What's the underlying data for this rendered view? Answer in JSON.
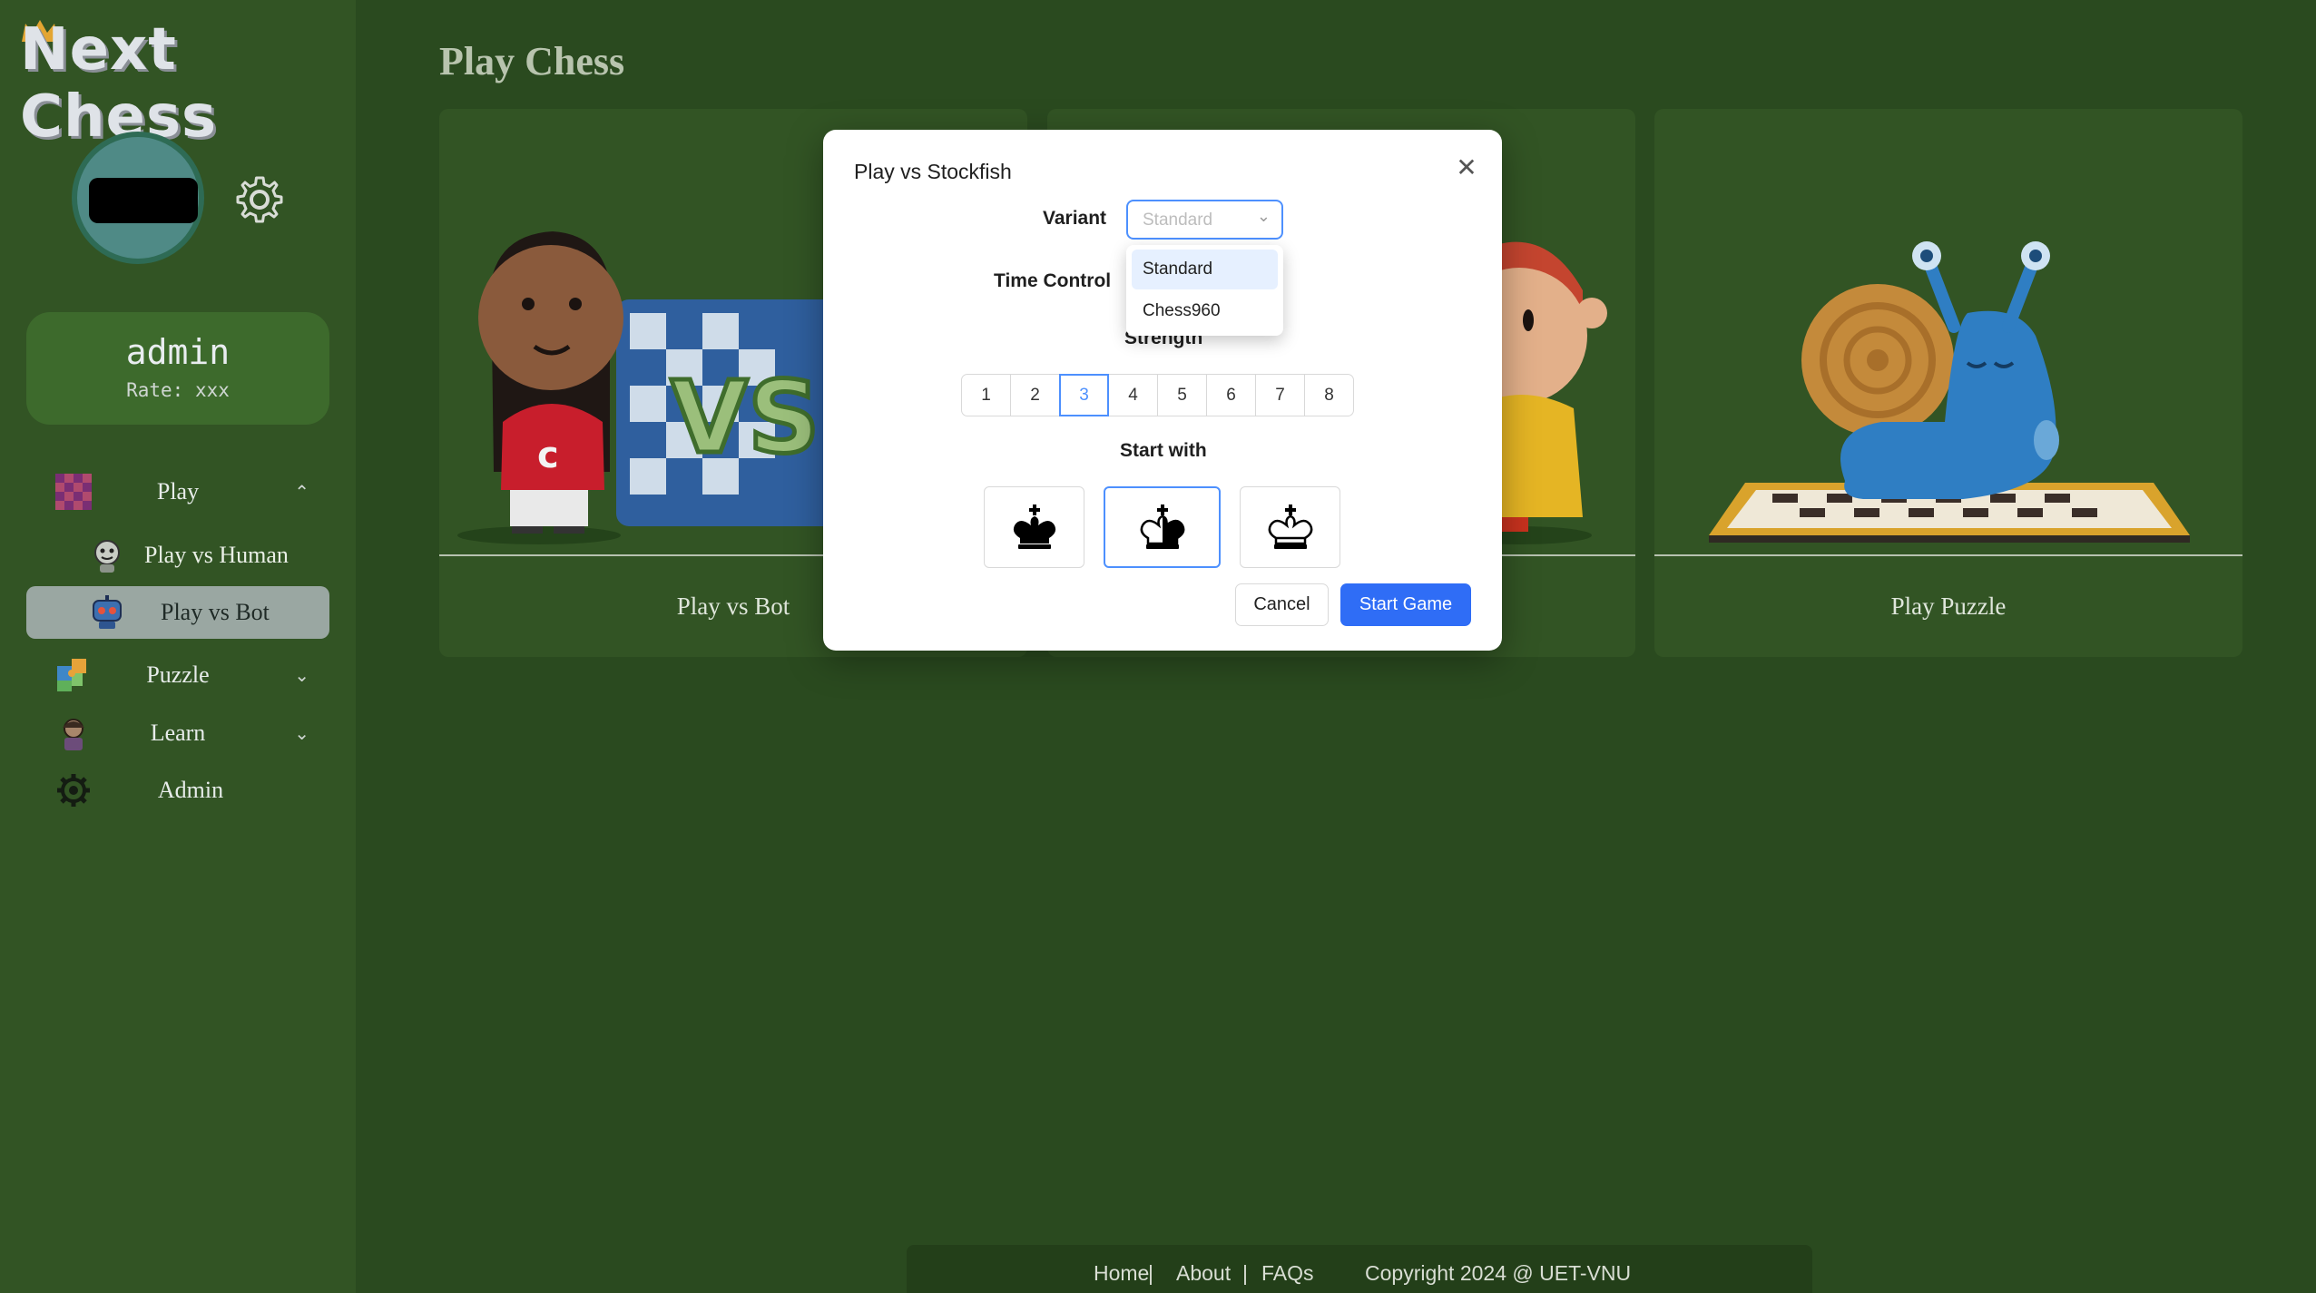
{
  "app": {
    "logo": "Next Chess"
  },
  "user": {
    "name": "admin",
    "rate": "Rate: xxx"
  },
  "sidebar": {
    "items": [
      {
        "label": "Play",
        "chevron": "⌃"
      },
      {
        "label": "Play vs Human"
      },
      {
        "label": "Play vs Bot"
      },
      {
        "label": "Puzzle",
        "chevron": "⌄"
      },
      {
        "label": "Learn",
        "chevron": "⌄"
      },
      {
        "label": "Admin"
      }
    ]
  },
  "main": {
    "title": "Play Chess",
    "cards": [
      {
        "label": "Play vs Bot"
      },
      {
        "label": ""
      },
      {
        "label": "Play Puzzle"
      }
    ]
  },
  "modal": {
    "title": "Play vs Stockfish",
    "variant_label": "Variant",
    "variant_placeholder": "Standard",
    "variant_options": [
      "Standard",
      "Chess960"
    ],
    "time_control_label": "Time Control",
    "strength_label": "Strength",
    "strength_levels": [
      "1",
      "2",
      "3",
      "4",
      "5",
      "6",
      "7",
      "8"
    ],
    "strength_selected": "3",
    "start_with_label": "Start with",
    "start_with_options": [
      "black-king-icon",
      "random-king-icon",
      "white-king-icon"
    ],
    "cancel_label": "Cancel",
    "start_label": "Start Game"
  },
  "footer": {
    "links": [
      "Home",
      "|",
      "About",
      "|",
      "FAQs"
    ],
    "copyright": "Copyright 2024 @ UET-VNU"
  },
  "colors": {
    "page_bg": "#2a4a1f",
    "sidebar_bg": "#325424",
    "accent": "#4d90fe",
    "primary_button": "#2f6df6"
  }
}
